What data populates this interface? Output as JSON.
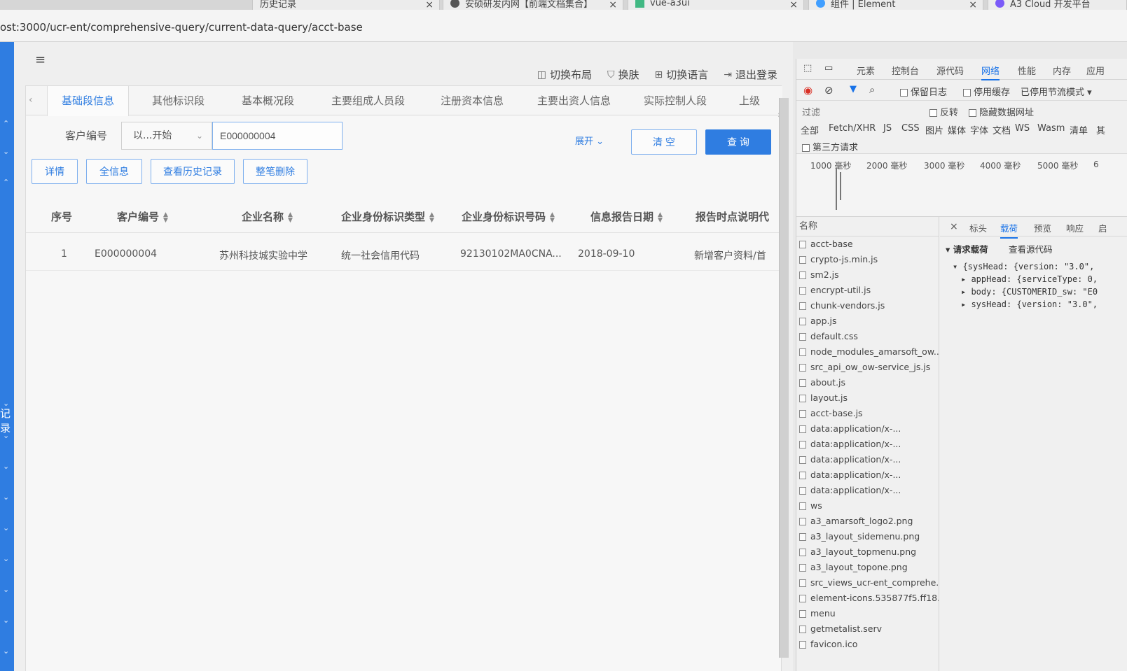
{
  "browser": {
    "tabs": [
      {
        "label": "历史记录",
        "color": "#888888"
      },
      {
        "label": "安硕研发内网【前端文档集合】",
        "color": "#555555"
      },
      {
        "label": "vue-a3ui",
        "color": "#41b883"
      },
      {
        "label": "组件 | Element",
        "color": "#409eff"
      },
      {
        "label": "A3 Cloud 开发平台",
        "color": "#7a5af8"
      }
    ],
    "close_glyph": "×",
    "url": "ost:3000/ucr-ent/comprehensive-query/current-data-query/acct-base"
  },
  "sidebar": {
    "text": "记录",
    "accent": "#2f7de1"
  },
  "app": {
    "menu_icon": "≡",
    "topbar": [
      {
        "label": "切换布局",
        "icon": "layout-icon"
      },
      {
        "label": "换肤",
        "icon": "shirt-icon"
      },
      {
        "label": "切换语言",
        "icon": "grid-icon"
      },
      {
        "label": "退出登录",
        "icon": "logout-icon"
      }
    ],
    "tabs": [
      "基础段信息",
      "其他标识段",
      "基本概况段",
      "主要组成人员段",
      "注册资本信息",
      "主要出资人信息",
      "实际控制人段",
      "上级"
    ],
    "active_tab": 0,
    "search": {
      "label": "客户编号",
      "match_mode": "以...开始",
      "value": "E000000004",
      "expand_label": "展开",
      "clear_label": "清 空",
      "query_label": "查 询"
    },
    "actions": [
      "详情",
      "全信息",
      "查看历史记录",
      "整笔删除"
    ],
    "table": {
      "columns": [
        "序号",
        "客户编号",
        "企业名称",
        "企业身份标识类型",
        "企业身份标识号码",
        "信息报告日期",
        "报告时点说明代"
      ],
      "rows": [
        [
          "1",
          "E000000004",
          "苏州科技城实验中学",
          "统一社会信用代码",
          "92130102MA0CNA...",
          "2018-09-10",
          "新增客户资料/首"
        ]
      ]
    }
  },
  "devtools": {
    "tabs": [
      "元素",
      "控制台",
      "源代码",
      "网络",
      "性能",
      "内存",
      "应用"
    ],
    "active_tab": 3,
    "toolbar": {
      "preserve_log": "保留日志",
      "disable_cache": "停用缓存",
      "throttle": "已停用节流模式"
    },
    "filter": {
      "label": "过滤",
      "invert": "反转",
      "hide_data_urls": "隐藏数据网址"
    },
    "types": [
      "全部",
      "Fetch/XHR",
      "JS",
      "CSS",
      "图片",
      "媒体",
      "字体",
      "文档",
      "WS",
      "Wasm",
      "清单",
      "其"
    ],
    "third_party": "第三方请求",
    "timeline": [
      "1000 毫秒",
      "2000 毫秒",
      "3000 毫秒",
      "4000 毫秒",
      "5000 毫秒",
      "6"
    ],
    "list_header": "名称",
    "requests": [
      "acct-base",
      "crypto-js.min.js",
      "sm2.js",
      "encrypt-util.js",
      "chunk-vendors.js",
      "app.js",
      "default.css",
      "node_modules_amarsoft_ow...",
      "src_api_ow_ow-service_js.js",
      "about.js",
      "layout.js",
      "acct-base.js",
      "data:application/x-...",
      "data:application/x-...",
      "data:application/x-...",
      "data:application/x-...",
      "data:application/x-...",
      "ws",
      "a3_amarsoft_logo2.png",
      "a3_layout_sidemenu.png",
      "a3_layout_topmenu.png",
      "a3_layout_topone.png",
      "src_views_ucr-ent_comprehe...",
      "element-icons.535877f5.ff18...",
      "menu",
      "getmetalist.serv",
      "favicon.ico"
    ],
    "detail_close": "×",
    "detail_tabs": [
      "标头",
      "载荷",
      "预览",
      "响应",
      "启"
    ],
    "detail_active": 1,
    "payload_title": "▾ 请求载荷",
    "view_source": "查看源代码",
    "payload_lines": [
      {
        "text": "▾ {sysHead: {version: \"3.0\",",
        "indent": 0
      },
      {
        "text": "▸ appHead: {serviceType: 0,",
        "indent": 1
      },
      {
        "text": "▸ body: {CUSTOMERID_sw: \"E0",
        "indent": 1
      },
      {
        "text": "▸ sysHead: {version: \"3.0\",",
        "indent": 1
      }
    ]
  }
}
